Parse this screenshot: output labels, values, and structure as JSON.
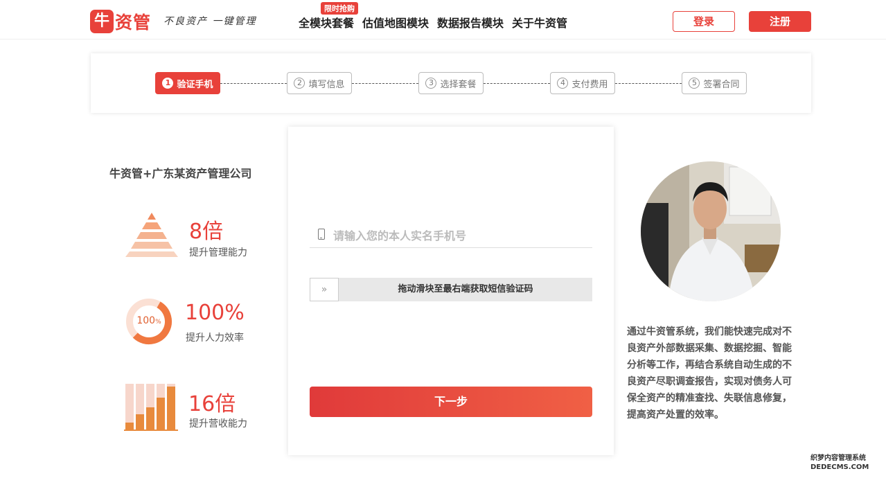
{
  "header": {
    "logo_mark": "牛",
    "logo_text": "资管",
    "slogan": "不良资产 一键管理",
    "nav": [
      {
        "label": "全模块套餐",
        "badge": "限时抢购"
      },
      {
        "label": "估值地图模块"
      },
      {
        "label": "数据报告模块"
      },
      {
        "label": "关于牛资管"
      }
    ],
    "login_label": "登录",
    "register_label": "注册"
  },
  "steps": [
    {
      "num": "1",
      "label": "验证手机",
      "active": true
    },
    {
      "num": "2",
      "label": "填写信息",
      "active": false
    },
    {
      "num": "3",
      "label": "选择套餐",
      "active": false
    },
    {
      "num": "4",
      "label": "支付费用",
      "active": false
    },
    {
      "num": "5",
      "label": "签署合同",
      "active": false
    }
  ],
  "left": {
    "company": "牛资管+广东某资产管理公司",
    "stats": [
      {
        "value": "8倍",
        "label": "提升管理能力",
        "icon": "pyramid-icon"
      },
      {
        "value": "100%",
        "label": "提升人力效率",
        "icon": "ring-chart-icon",
        "ring_text": "100",
        "ring_unit": "%"
      },
      {
        "value": "16倍",
        "label": "提升营收能力",
        "icon": "bar-chart-icon"
      }
    ]
  },
  "form": {
    "phone_placeholder": "请输入您的本人实名手机号",
    "slider_handle": "»",
    "slider_text": "拖动滑块至最右端获取短信验证码",
    "next_label": "下一步"
  },
  "right": {
    "description": "通过牛资管系统，我们能快速完成对不良资产外部数据采集、数据挖掘、智能分析等工作，再结合系统自动生成的不良资产尽职调查报告，实现对债务人可保全资产的精准查找、失联信息修复，提高资产处置的效率。"
  },
  "watermark": {
    "line1": "织梦内容管理系统",
    "line2": "DEDECMS.COM"
  },
  "colors": {
    "accent": "#e8413a",
    "orange": "#f08050"
  }
}
